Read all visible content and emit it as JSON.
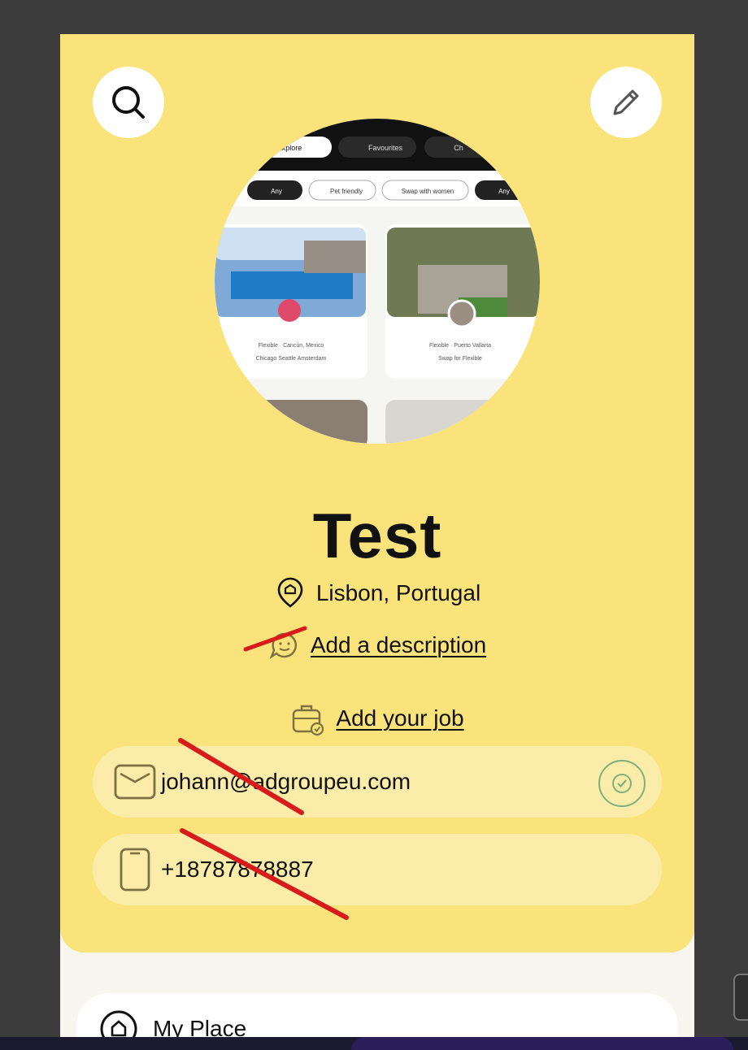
{
  "profile": {
    "name": "Test",
    "location": "Lisbon, Portugal",
    "description_link": "Add a description",
    "job_link": "Add your job",
    "email": "johann@adgroupeu.com",
    "phone": "+18787878887"
  },
  "avatar_preview": {
    "tabs": [
      "Explore",
      "Favourites",
      "Ch"
    ],
    "filters": [
      "Any",
      "Pet friendly",
      "Swap with women",
      "Any"
    ],
    "listing_1": {
      "tags": "Flexible  ·  Cancún, Mexico",
      "wants": "Chicago  Seattle  Amsterdam"
    },
    "listing_2": {
      "tags": "Flexible  ·  Puerto Vallarta",
      "wants": "Swap for Flexible"
    }
  },
  "place_section": {
    "label": "My Place"
  },
  "colors": {
    "card": "#f9e37a",
    "pill": "#fbeda9",
    "annotation": "#d91a1a",
    "verified": "#7fb07a"
  },
  "icons": {
    "search": "search-icon",
    "edit": "pencil-icon",
    "location": "location-pin-icon",
    "description": "chat-bubble-icon",
    "job": "briefcase-icon",
    "email": "envelope-icon",
    "phone": "phone-icon",
    "verified": "check-circle-icon",
    "place": "home-icon"
  }
}
